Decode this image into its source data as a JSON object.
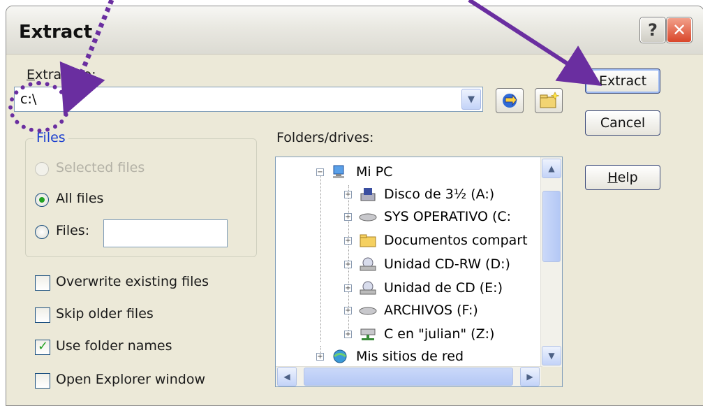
{
  "window": {
    "title": "Extract",
    "help_glyph": "?",
    "close_glyph": "✕"
  },
  "extract_to": {
    "label": "Extract to:",
    "value": "c:\\"
  },
  "buttons": {
    "extract": "Extract",
    "cancel": "Cancel",
    "help": "Help"
  },
  "files_group": {
    "legend": "Files",
    "selected_files": "Selected files",
    "all_files": "All files",
    "files": "Files:",
    "files_value": "",
    "selected": "all_files"
  },
  "options": [
    {
      "label": "Overwrite existing files",
      "checked": false
    },
    {
      "label": "Skip older files",
      "checked": false
    },
    {
      "label": "Use folder names",
      "checked": true
    },
    {
      "label": "Open Explorer window",
      "checked": false
    }
  ],
  "folders": {
    "label": "Folders/drives:",
    "items": [
      {
        "label": "Mi PC",
        "icon": "computer-icon",
        "expander": "−"
      },
      {
        "label": "Disco de 3½ (A:)",
        "icon": "floppy-drive-icon",
        "expander": "+"
      },
      {
        "label": "SYS OPERATIVO (C:",
        "icon": "hard-drive-icon",
        "expander": "+"
      },
      {
        "label": "Documentos compart",
        "icon": "folder-icon",
        "expander": "+"
      },
      {
        "label": "Unidad CD-RW (D:)",
        "icon": "cd-drive-icon",
        "expander": "+"
      },
      {
        "label": "Unidad de CD (E:)",
        "icon": "cd-drive-icon",
        "expander": "+"
      },
      {
        "label": "ARCHIVOS (F:)",
        "icon": "hard-drive-icon",
        "expander": "+"
      },
      {
        "label": "C en \"julian\" (Z:)",
        "icon": "network-drive-icon",
        "expander": "+"
      },
      {
        "label": "Mis sitios de red",
        "icon": "network-places-icon",
        "expander": "+"
      }
    ]
  },
  "colors": {
    "annotation": "#6a2ea0",
    "dialog_bg": "#ece9d8",
    "accent": "#1a3ecf"
  }
}
